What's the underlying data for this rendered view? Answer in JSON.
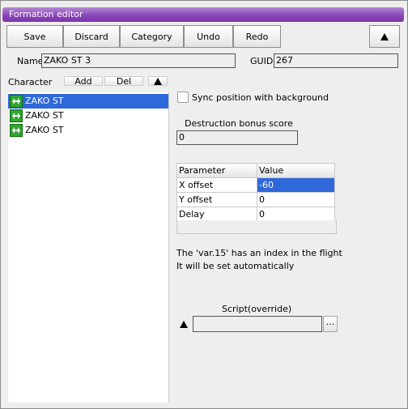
{
  "window": {
    "title": "Formation editor"
  },
  "toolbar": {
    "save": "Save",
    "discard": "Discard",
    "category": "Category",
    "undo": "Undo",
    "redo": "Redo"
  },
  "name_field": {
    "label": "Name",
    "value": "ZAKO ST 3"
  },
  "guid_field": {
    "label": "GUID",
    "value": "267"
  },
  "character_list": {
    "label": "Character",
    "add_label": "Add",
    "del_label": "Del",
    "items": [
      {
        "label": "ZAKO ST",
        "selected": true
      },
      {
        "label": "ZAKO ST",
        "selected": false
      },
      {
        "label": "ZAKO ST",
        "selected": false
      }
    ]
  },
  "sync_checkbox": {
    "label": "Sync position with background",
    "checked": false
  },
  "destruction": {
    "label": "Destruction bonus score",
    "value": "0"
  },
  "params_table": {
    "headers": [
      "Parameter",
      "Value"
    ],
    "rows": [
      {
        "param": "X offset",
        "value": "-60"
      },
      {
        "param": "Y offset",
        "value": "0"
      },
      {
        "param": "Delay",
        "value": "0"
      }
    ]
  },
  "info": {
    "line1": "The 'var.15' has an index in the flight",
    "line2": "It will be set automatically"
  },
  "script": {
    "label": "Script(override)",
    "value": "",
    "browse_label": "..."
  }
}
